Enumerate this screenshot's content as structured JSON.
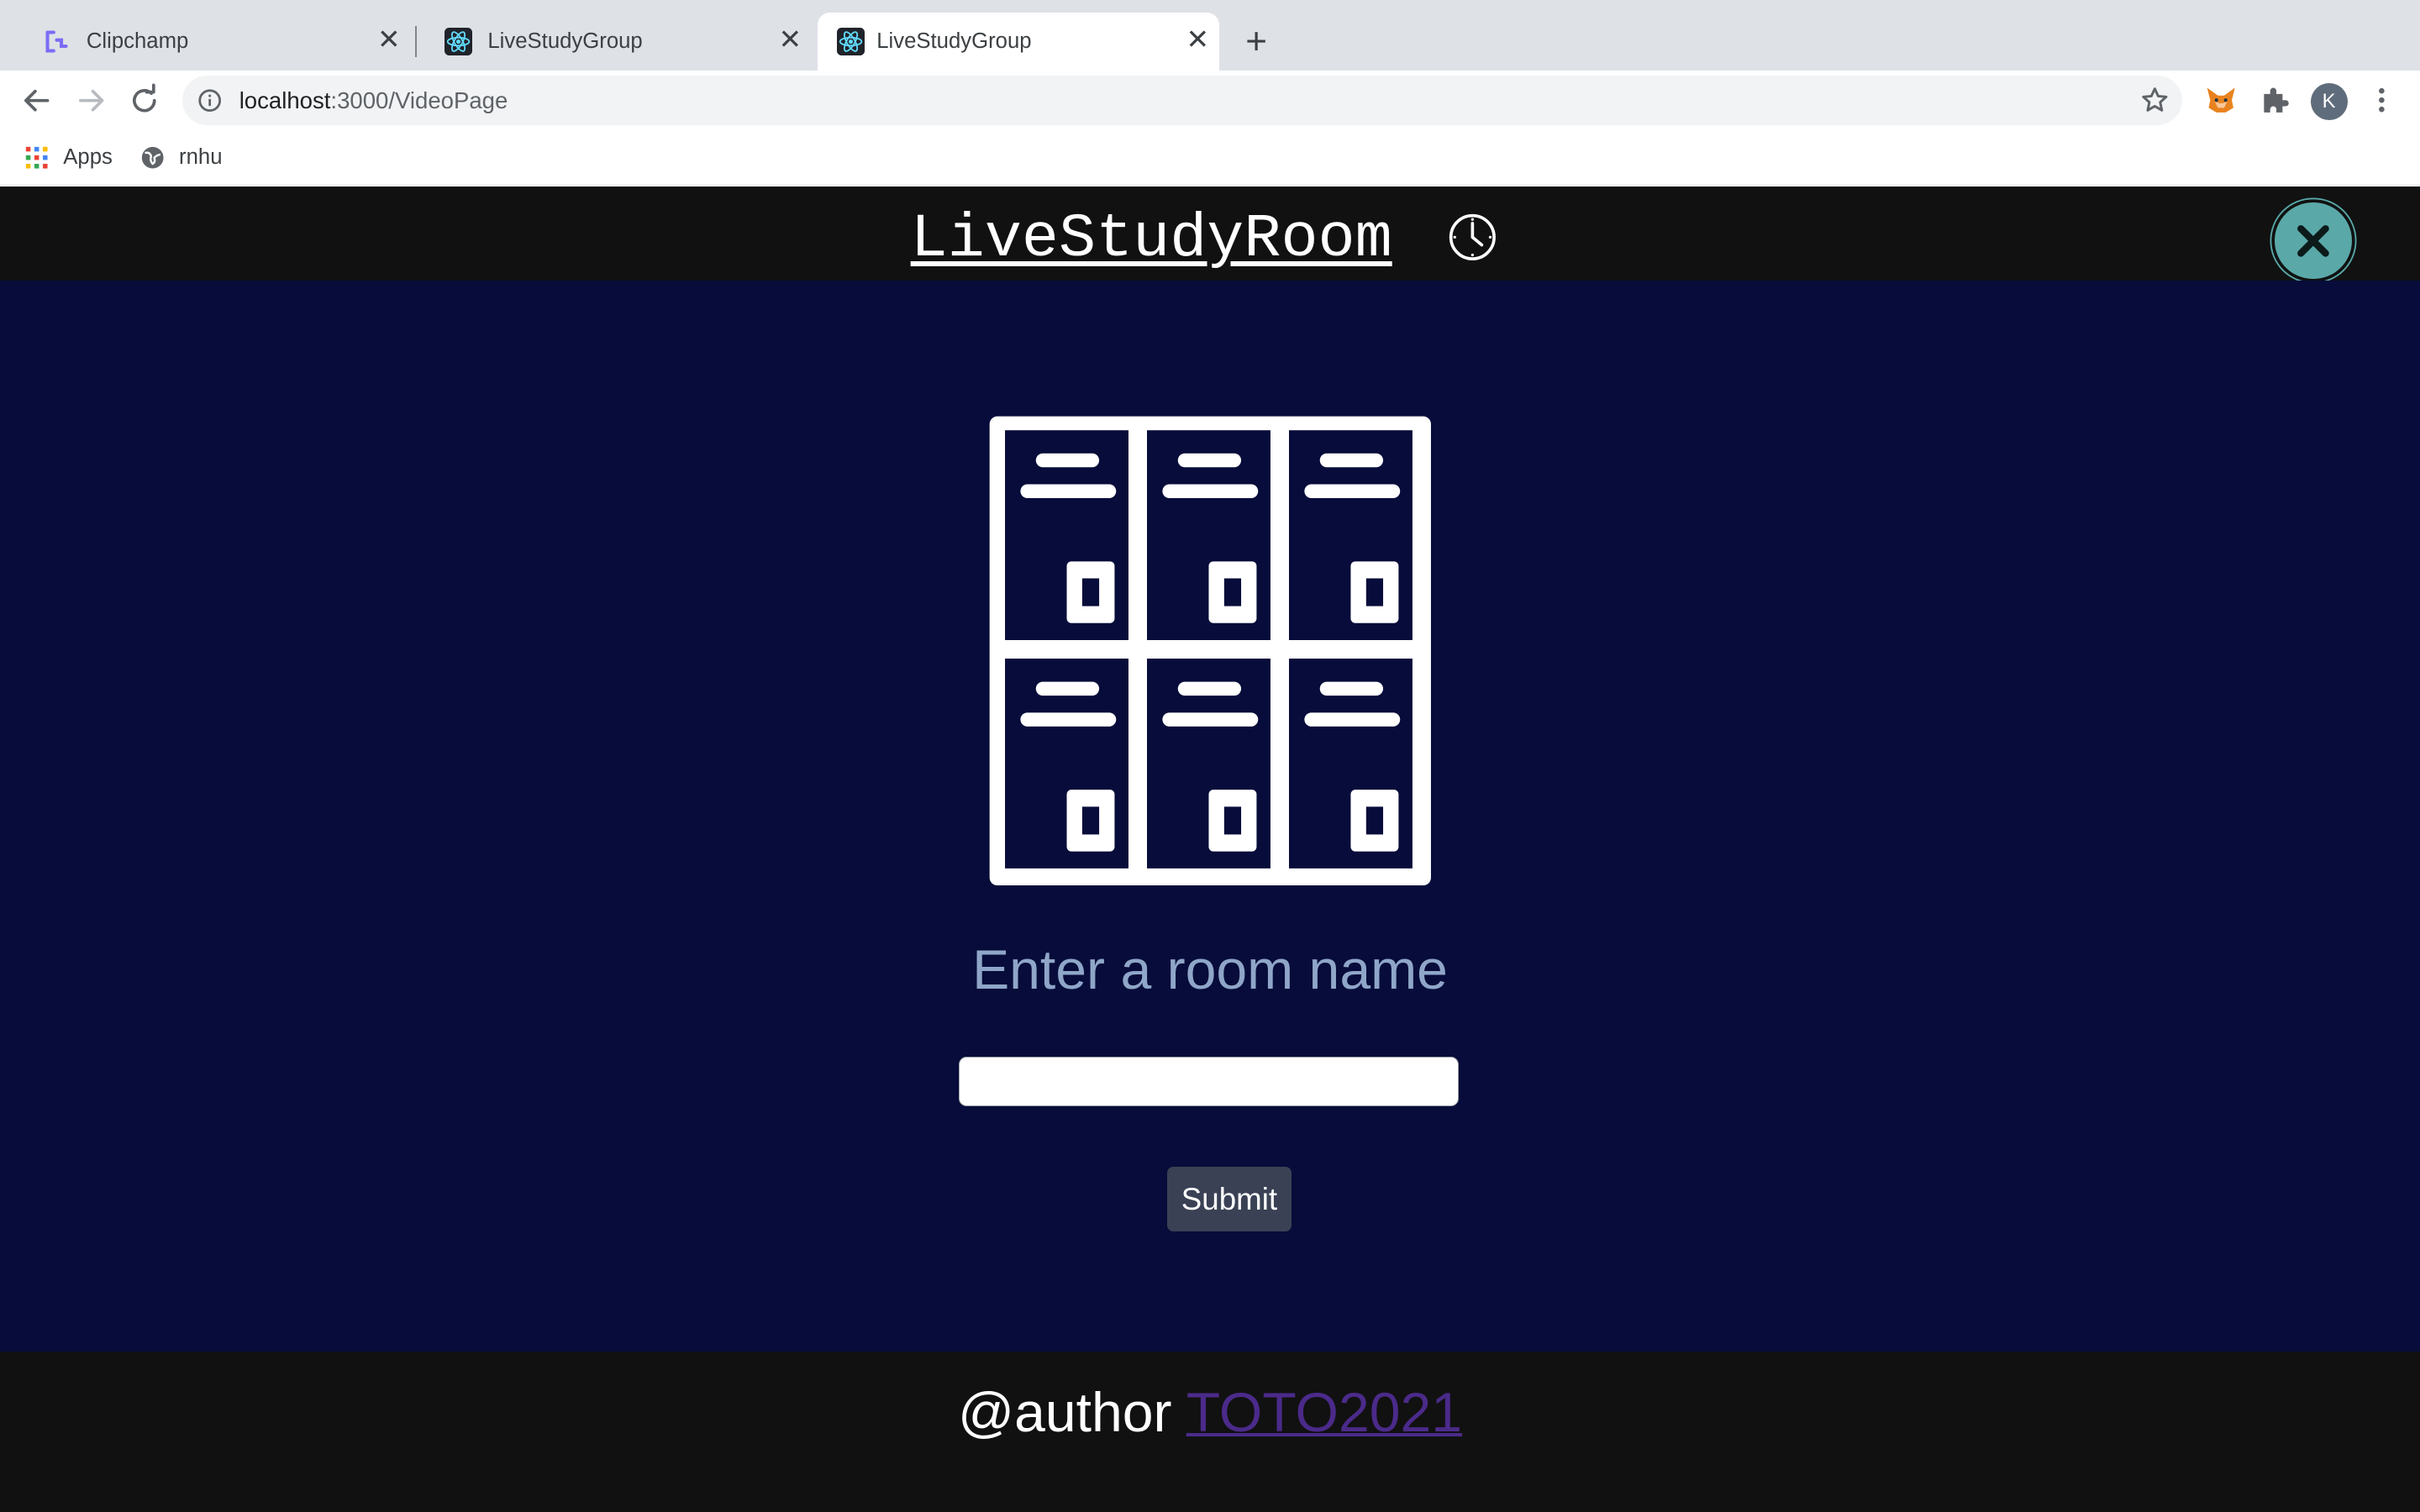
{
  "browser": {
    "tabs": [
      {
        "title": "Clipchamp",
        "favicon": "clipchamp-icon"
      },
      {
        "title": "LiveStudyGroup",
        "favicon": "react-icon"
      },
      {
        "title": "LiveStudyGroup",
        "favicon": "react-icon",
        "active": true
      }
    ],
    "address": {
      "host": "localhost",
      "path": ":3000/VideoPage"
    },
    "profile_initial": "K",
    "bookmarks": [
      {
        "label": "Apps",
        "icon": "apps-grid-icon"
      },
      {
        "label": "rnhu",
        "icon": "globe-icon"
      }
    ]
  },
  "app": {
    "title": "LiveStudyRoom",
    "title_icon": "clock-icon",
    "close_icon": "close-icon",
    "colors": {
      "header_bg": "#111111",
      "main_bg": "#070c3a",
      "close_button": "#5aa8a8",
      "prompt": "#8fa6c8",
      "link": "#4b2a8a"
    }
  },
  "main": {
    "illustration": "lockers-icon",
    "prompt": "Enter a room name",
    "room_input": {
      "value": "",
      "placeholder": ""
    },
    "submit_label": "Submit"
  },
  "footer": {
    "prefix": "@author ",
    "link_text": "TOTO2021"
  }
}
